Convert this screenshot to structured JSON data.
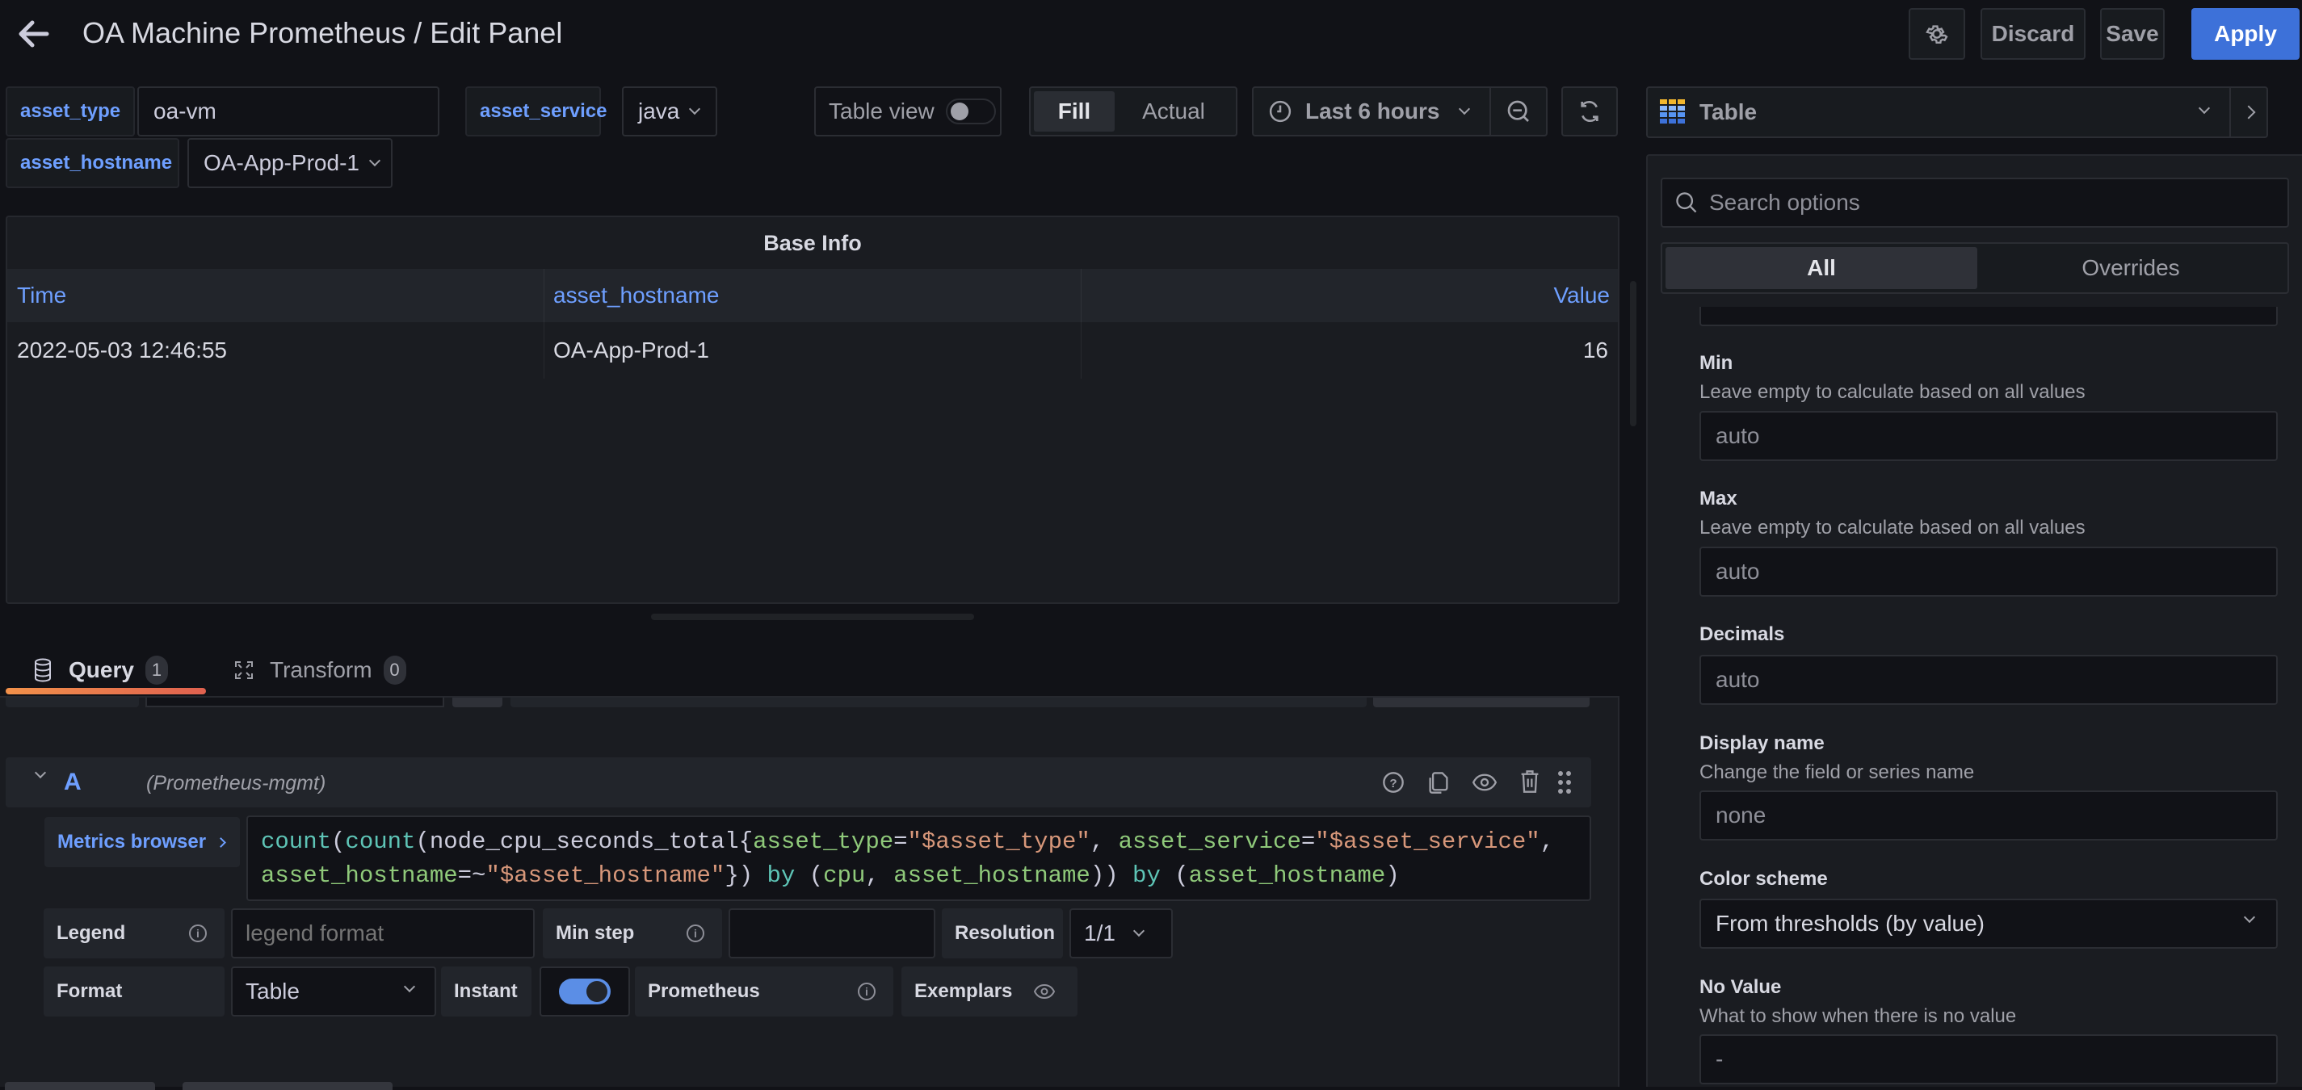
{
  "header": {
    "title": "OA Machine Prometheus / Edit Panel",
    "back_icon": "arrow-left-icon",
    "settings_icon": "gear-icon",
    "discard_label": "Discard",
    "save_label": "Save",
    "apply_label": "Apply"
  },
  "variables": [
    {
      "name": "asset_type",
      "value": "oa-vm",
      "kind": "textbox"
    },
    {
      "name": "asset_service",
      "value": "java",
      "kind": "select"
    },
    {
      "name": "asset_hostname",
      "value": "OA-App-Prod-1",
      "kind": "select"
    }
  ],
  "toolbar": {
    "table_view_label": "Table view",
    "table_view_on": false,
    "fill_label": "Fill",
    "actual_label": "Actual",
    "fill_selected": true,
    "time_range": "Last 6 hours",
    "clock_icon": "clock-icon",
    "zoom_out_icon": "zoom-out-icon",
    "refresh_icon": "refresh-icon"
  },
  "panel": {
    "title": "Base Info",
    "columns": [
      "Time",
      "asset_hostname",
      "Value"
    ],
    "rows": [
      [
        "2022-05-03 12:46:55",
        "OA-App-Prod-1",
        "16"
      ]
    ]
  },
  "tabs": [
    {
      "label": "Query",
      "count": "1",
      "icon": "database-icon",
      "active": true
    },
    {
      "label": "Transform",
      "count": "0",
      "icon": "transform-icon",
      "active": false
    }
  ],
  "query": {
    "ref_id": "A",
    "datasource": "(Prometheus-mgmt)",
    "metrics_browser_label": "Metrics browser",
    "expr_line1": [
      {
        "t": "count",
        "c": "fn"
      },
      {
        "t": "(",
        "c": "pun"
      },
      {
        "t": "count",
        "c": "fn"
      },
      {
        "t": "(node_cpu_seconds_total{",
        "c": "pun"
      },
      {
        "t": "asset_type",
        "c": "lab"
      },
      {
        "t": "=",
        "c": "pun"
      },
      {
        "t": "\"$asset_type\"",
        "c": "str"
      },
      {
        "t": ", ",
        "c": "pun"
      },
      {
        "t": "asset_service",
        "c": "lab"
      },
      {
        "t": "=",
        "c": "pun"
      },
      {
        "t": "\"$asset_service\"",
        "c": "str"
      },
      {
        "t": ",",
        "c": "pun"
      }
    ],
    "expr_line2": [
      {
        "t": "asset_hostname",
        "c": "lab"
      },
      {
        "t": "=~",
        "c": "pun"
      },
      {
        "t": "\"$asset_hostname\"",
        "c": "str"
      },
      {
        "t": "}) ",
        "c": "pun"
      },
      {
        "t": "by",
        "c": "kw"
      },
      {
        "t": " (",
        "c": "pun"
      },
      {
        "t": "cpu",
        "c": "lab"
      },
      {
        "t": ", ",
        "c": "pun"
      },
      {
        "t": "asset_hostname",
        "c": "lab"
      },
      {
        "t": ")) ",
        "c": "pun"
      },
      {
        "t": "by",
        "c": "kw"
      },
      {
        "t": " (",
        "c": "pun"
      },
      {
        "t": "asset_hostname",
        "c": "lab"
      },
      {
        "t": ")",
        "c": "pun"
      }
    ],
    "legend_label": "Legend",
    "legend_placeholder": "legend format",
    "min_step_label": "Min step",
    "min_step_value": "",
    "resolution_label": "Resolution",
    "resolution_value": "1/1",
    "format_label": "Format",
    "format_value": "Table",
    "instant_label": "Instant",
    "instant_on": true,
    "prometheus_label": "Prometheus",
    "exemplars_label": "Exemplars"
  },
  "options_pane": {
    "visualization": "Table",
    "search_placeholder": "Search options",
    "tab_all": "All",
    "tab_overrides": "Overrides",
    "fields": [
      {
        "title": "Min",
        "description": "Leave empty to calculate based on all values",
        "value": "auto"
      },
      {
        "title": "Max",
        "description": "Leave empty to calculate based on all values",
        "value": "auto"
      },
      {
        "title": "Decimals",
        "description": "",
        "value": "auto"
      },
      {
        "title": "Display name",
        "description": "Change the field or series name",
        "value": "none"
      },
      {
        "title": "Color scheme",
        "description": "",
        "value": "From thresholds (by value)"
      },
      {
        "title": "No Value",
        "description": "What to show when there is no value",
        "value": "-"
      }
    ]
  },
  "colors": {
    "accent": "#3d71d9",
    "link_blue": "#6e9fff",
    "tab_underline_start": "#f2914a",
    "tab_underline_end": "#e0614f"
  }
}
